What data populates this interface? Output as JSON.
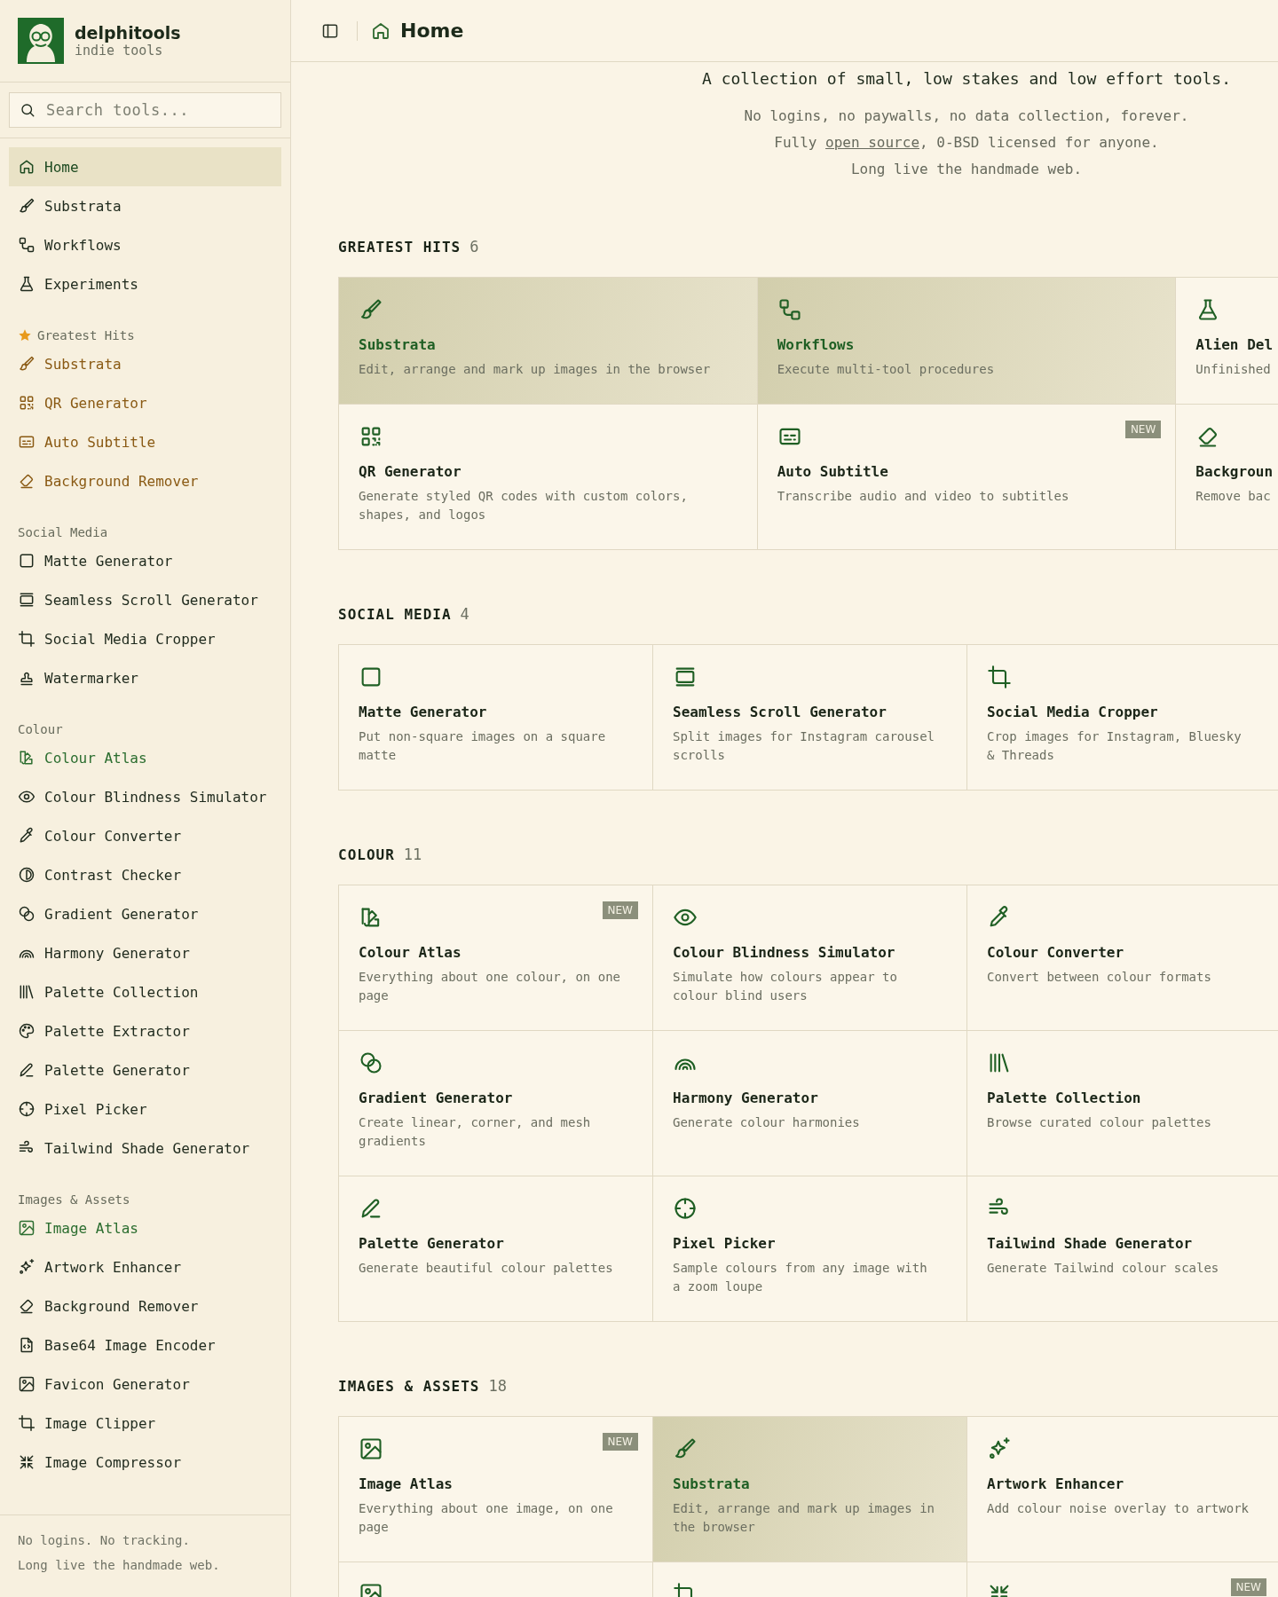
{
  "brand": {
    "name": "delphitools",
    "tagline": "indie tools"
  },
  "search": {
    "placeholder": "Search tools..."
  },
  "nav": [
    {
      "label": "Home",
      "selected": true
    },
    {
      "label": "Substrata",
      "selected": false
    },
    {
      "label": "Workflows",
      "selected": false
    },
    {
      "label": "Experiments",
      "selected": false
    }
  ],
  "sidebar_sections": [
    {
      "title": "Greatest Hits",
      "starred": true,
      "items": [
        {
          "label": "Substrata",
          "color": "#8a5a14",
          "selected": false
        },
        {
          "label": "QR Generator",
          "color": "#8a5a14",
          "selected": false
        },
        {
          "label": "Auto Subtitle",
          "color": "#8a5a14",
          "selected": false
        },
        {
          "label": "Background Remover",
          "color": "#8a5a14",
          "selected": false
        }
      ]
    },
    {
      "title": "Social Media",
      "starred": false,
      "items": [
        {
          "label": "Matte Generator",
          "color": "#1f2a1d",
          "selected": false
        },
        {
          "label": "Seamless Scroll Generator",
          "color": "#1f2a1d",
          "selected": false
        },
        {
          "label": "Social Media Cropper",
          "color": "#1f2a1d",
          "selected": false
        },
        {
          "label": "Watermarker",
          "color": "#1f2a1d",
          "selected": false
        }
      ]
    },
    {
      "title": "Colour",
      "starred": false,
      "items": [
        {
          "label": "Colour Atlas",
          "color": "#2c6e30",
          "selected": false
        },
        {
          "label": "Colour Blindness Simulator",
          "color": "#1f2a1d",
          "selected": false
        },
        {
          "label": "Colour Converter",
          "color": "#1f2a1d",
          "selected": false
        },
        {
          "label": "Contrast Checker",
          "color": "#1f2a1d",
          "selected": false
        },
        {
          "label": "Gradient Generator",
          "color": "#1f2a1d",
          "selected": false
        },
        {
          "label": "Harmony Generator",
          "color": "#1f2a1d",
          "selected": false
        },
        {
          "label": "Palette Collection",
          "color": "#1f2a1d",
          "selected": false
        },
        {
          "label": "Palette Extractor",
          "color": "#1f2a1d",
          "selected": false
        },
        {
          "label": "Palette Generator",
          "color": "#1f2a1d",
          "selected": false
        },
        {
          "label": "Pixel Picker",
          "color": "#1f2a1d",
          "selected": false
        },
        {
          "label": "Tailwind Shade Generator",
          "color": "#1f2a1d",
          "selected": false
        }
      ]
    },
    {
      "title": "Images & Assets",
      "starred": false,
      "items": [
        {
          "label": "Image Atlas",
          "color": "#2c6e30",
          "selected": false
        },
        {
          "label": "Artwork Enhancer",
          "color": "#1f2a1d",
          "selected": false
        },
        {
          "label": "Background Remover",
          "color": "#1f2a1d",
          "selected": false
        },
        {
          "label": "Base64 Image Encoder",
          "color": "#1f2a1d",
          "selected": false
        },
        {
          "label": "Favicon Generator",
          "color": "#1f2a1d",
          "selected": false
        },
        {
          "label": "Image Clipper",
          "color": "#1f2a1d",
          "selected": false
        },
        {
          "label": "Image Compressor",
          "color": "#1f2a1d",
          "selected": false
        }
      ]
    }
  ],
  "sidebar_footer": [
    "No logins. No tracking.",
    "Long live the handmade web."
  ],
  "header": {
    "title": "Home"
  },
  "intro": {
    "headline": "A collection of small, low stakes and low effort tools.",
    "lines": [
      {
        "before": "No logins, no paywalls, no data collection, forever."
      },
      {
        "before": "Fully ",
        "link": "open source",
        "after": ", 0-BSD licensed for anyone."
      },
      {
        "before": "Long live the handmade web."
      }
    ]
  },
  "sections": [
    {
      "title": "GREATEST HITS",
      "count": "6",
      "kind": "hits",
      "cards": [
        {
          "title": "Substrata",
          "description": "Edit, arrange and mark up images in the browser",
          "featured": true
        },
        {
          "title": "Workflows",
          "description": "Execute multi-tool procedures",
          "featured": true
        },
        {
          "title": "Alien Del",
          "description": "Unfinished",
          "featured": false
        },
        {
          "title": "QR Generator",
          "description": "Generate styled QR codes with custom colors, shapes, and logos",
          "featured": false
        },
        {
          "title": "Auto Subtitle",
          "description": "Transcribe audio and video to subtitles",
          "featured": false,
          "badge": "NEW"
        },
        {
          "title": "Backgroun",
          "description": "Remove bac",
          "featured": false
        }
      ]
    },
    {
      "title": "SOCIAL MEDIA",
      "count": "4",
      "kind": "category",
      "cards": [
        {
          "title": "Matte Generator",
          "description": "Put non-square images on a square matte",
          "featured": false
        },
        {
          "title": "Seamless Scroll Generator",
          "description": "Split images for Instagram carousel scrolls",
          "featured": false
        },
        {
          "title": "Social Media Cropper",
          "description": "Crop images for Instagram, Bluesky & Threads",
          "featured": false
        }
      ]
    },
    {
      "title": "COLOUR",
      "count": "11",
      "kind": "category",
      "cards": [
        {
          "title": "Colour Atlas",
          "description": "Everything about one colour, on one page",
          "featured": false,
          "badge": "NEW"
        },
        {
          "title": "Colour Blindness Simulator",
          "description": "Simulate how colours appear to colour blind users",
          "featured": false
        },
        {
          "title": "Colour Converter",
          "description": "Convert between colour formats",
          "featured": false
        },
        {
          "title": "Gradient Generator",
          "description": "Create linear, corner, and mesh gradients",
          "featured": false
        },
        {
          "title": "Harmony Generator",
          "description": "Generate colour harmonies",
          "featured": false
        },
        {
          "title": "Palette Collection",
          "description": "Browse curated colour palettes",
          "featured": false
        },
        {
          "title": "Palette Generator",
          "description": "Generate beautiful colour palettes",
          "featured": false
        },
        {
          "title": "Pixel Picker",
          "description": "Sample colours from any image with a zoom loupe",
          "featured": false
        },
        {
          "title": "Tailwind Shade Generator",
          "description": "Generate Tailwind colour scales",
          "featured": false
        }
      ]
    },
    {
      "title": "IMAGES & ASSETS",
      "count": "18",
      "kind": "category",
      "cards": [
        {
          "title": "Image Atlas",
          "description": "Everything about one image, on one page",
          "featured": false,
          "badge": "NEW"
        },
        {
          "title": "Substrata",
          "description": "Edit, arrange and mark up images in the browser",
          "featured": true
        },
        {
          "title": "Artwork Enhancer",
          "description": "Add colour noise overlay to artwork",
          "featured": false
        },
        {
          "featured": false
        },
        {
          "featured": false
        },
        {
          "featured": false,
          "badge": "NEW"
        }
      ]
    }
  ]
}
